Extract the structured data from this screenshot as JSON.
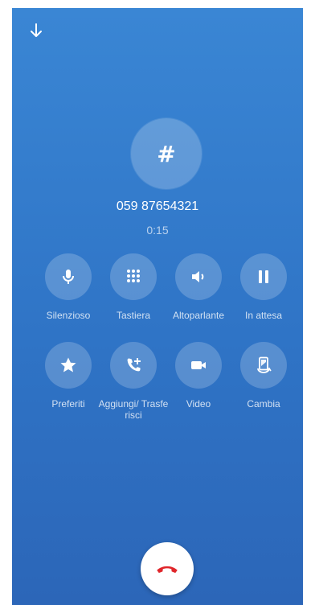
{
  "header": {
    "minimize_icon": "arrow-down-icon"
  },
  "contact": {
    "avatar_symbol": "#",
    "number": "059 87654321",
    "timer": "0:15"
  },
  "actions": [
    {
      "id": "mute",
      "label": "Silenzioso",
      "icon": "microphone-icon"
    },
    {
      "id": "keypad",
      "label": "Tastiera",
      "icon": "dialpad-icon"
    },
    {
      "id": "speaker",
      "label": "Altoparlante",
      "icon": "speaker-icon"
    },
    {
      "id": "hold",
      "label": "In attesa",
      "icon": "pause-icon"
    },
    {
      "id": "favorites",
      "label": "Preferiti",
      "icon": "star-icon"
    },
    {
      "id": "add_transfer",
      "label": "Aggiungi/ Trasferisci",
      "icon": "add-call-icon"
    },
    {
      "id": "video",
      "label": "Video",
      "icon": "video-camera-icon"
    },
    {
      "id": "switch",
      "label": "Cambia",
      "icon": "swap-device-icon"
    }
  ],
  "end_call": {
    "icon": "hangup-icon",
    "color": "#e0262b"
  },
  "colors": {
    "background_top": "#3a86d4",
    "background_bottom": "#2c66b8"
  }
}
